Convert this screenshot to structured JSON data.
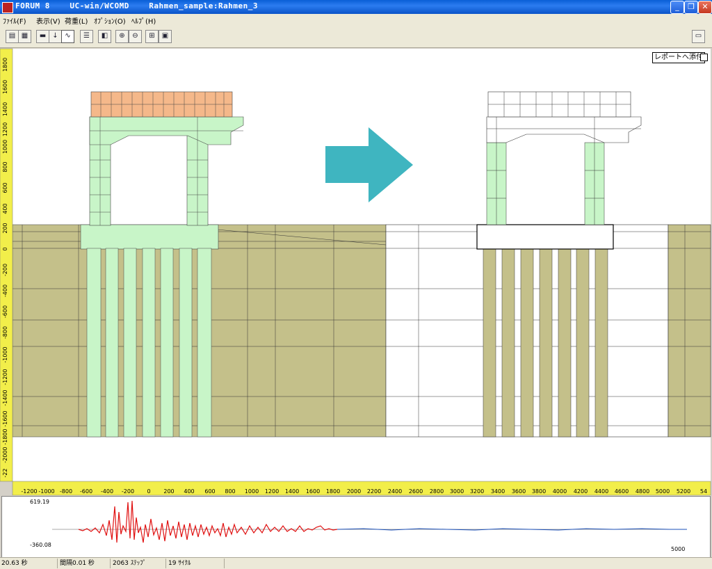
{
  "window": {
    "title": "FORUM 8    UC-win/WCOMD    Rahmen_sample:Rahmen_3",
    "min": "_",
    "max": "❐",
    "close": "✕"
  },
  "menu": [
    {
      "label": "ﾌｧｲﾙ(F)"
    },
    {
      "label": "表示(V)"
    },
    {
      "label": "荷重(L)"
    },
    {
      "label": "ｵﾌﾟｼｮﾝ(O)"
    },
    {
      "label": "ﾍﾙﾌﾟ(H)"
    }
  ],
  "toolbar": [
    {
      "icon": "open-icon",
      "glyph": "▤"
    },
    {
      "icon": "grid-icon",
      "glyph": "▦"
    },
    {
      "icon": "model-icon",
      "glyph": "▬"
    },
    {
      "icon": "load-arrow-icon",
      "glyph": "↓"
    },
    {
      "icon": "wave-icon",
      "glyph": "∿"
    },
    {
      "icon": "table-icon",
      "glyph": "☰"
    },
    {
      "icon": "layer-icon",
      "glyph": "◧"
    },
    {
      "icon": "zoom-in-icon",
      "glyph": "⊕"
    },
    {
      "icon": "zoom-out-icon",
      "glyph": "⊖"
    },
    {
      "icon": "fit-icon",
      "glyph": "⊞"
    },
    {
      "icon": "frame-icon",
      "glyph": "▣"
    },
    {
      "icon": "export-icon",
      "glyph": "▭"
    }
  ],
  "report_button": "レポートへ添付",
  "vertical_ruler": [
    "1800",
    "1600",
    "1400",
    "1200",
    "1000",
    "800",
    "600",
    "400",
    "200",
    "0",
    "-200",
    "-400",
    "-600",
    "-800",
    "-1000",
    "-1200",
    "-1400",
    "-1600",
    "-1800",
    "-2000",
    "-22"
  ],
  "horizontal_ruler": [
    "-1200",
    "-1000",
    "-800",
    "-600",
    "-400",
    "-200",
    "0",
    "200",
    "400",
    "600",
    "800",
    "1000",
    "1200",
    "1400",
    "1600",
    "1800",
    "2000",
    "2200",
    "2400",
    "2600",
    "2800",
    "3000",
    "3200",
    "3400",
    "3600",
    "3800",
    "4000",
    "4200",
    "4400",
    "4600",
    "4800",
    "5000",
    "5200",
    "54"
  ],
  "graph": {
    "ymax": "619.19",
    "ymin": "-360.08",
    "xmax": "5000"
  },
  "status": [
    "20.63 秒",
    "間隔0.01 秒",
    "2063 ｽﾃｯﾌﾟ",
    "19 ｻｲｸﾙ"
  ],
  "colors": {
    "soil": "#c4c08a",
    "concrete": "#c8f5c8",
    "beam": "#f5b88a",
    "arrow": "#3fb5c0",
    "wave_active": "#e01010",
    "wave_future": "#1a4fb8"
  }
}
